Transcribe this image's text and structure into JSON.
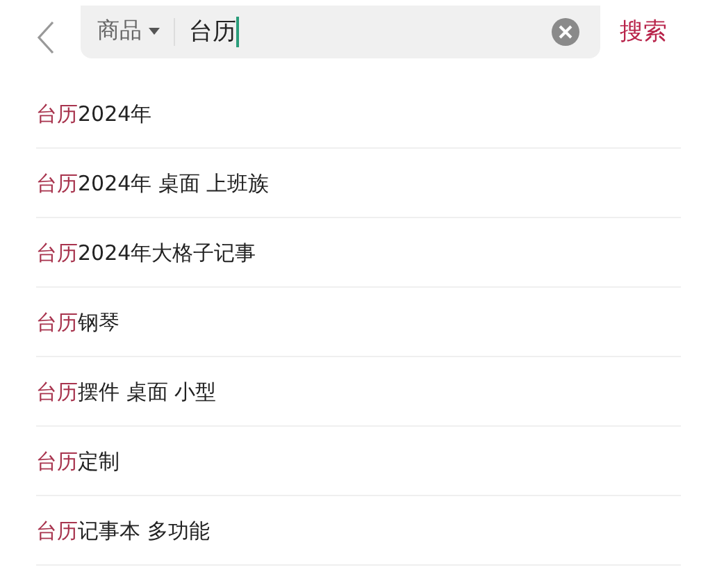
{
  "search": {
    "scope": "商品",
    "value": "台历",
    "submit": "搜索"
  },
  "suggestions": [
    {
      "match": "台历",
      "rest": "2024年"
    },
    {
      "match": "台历",
      "rest": "2024年 桌面 上班族"
    },
    {
      "match": "台历",
      "rest": "2024年大格子记事"
    },
    {
      "match": "台历",
      "rest": "钢琴"
    },
    {
      "match": "台历",
      "rest": "摆件 桌面 小型"
    },
    {
      "match": "台历",
      "rest": "定制"
    },
    {
      "match": "台历",
      "rest": "记事本 多功能"
    }
  ]
}
